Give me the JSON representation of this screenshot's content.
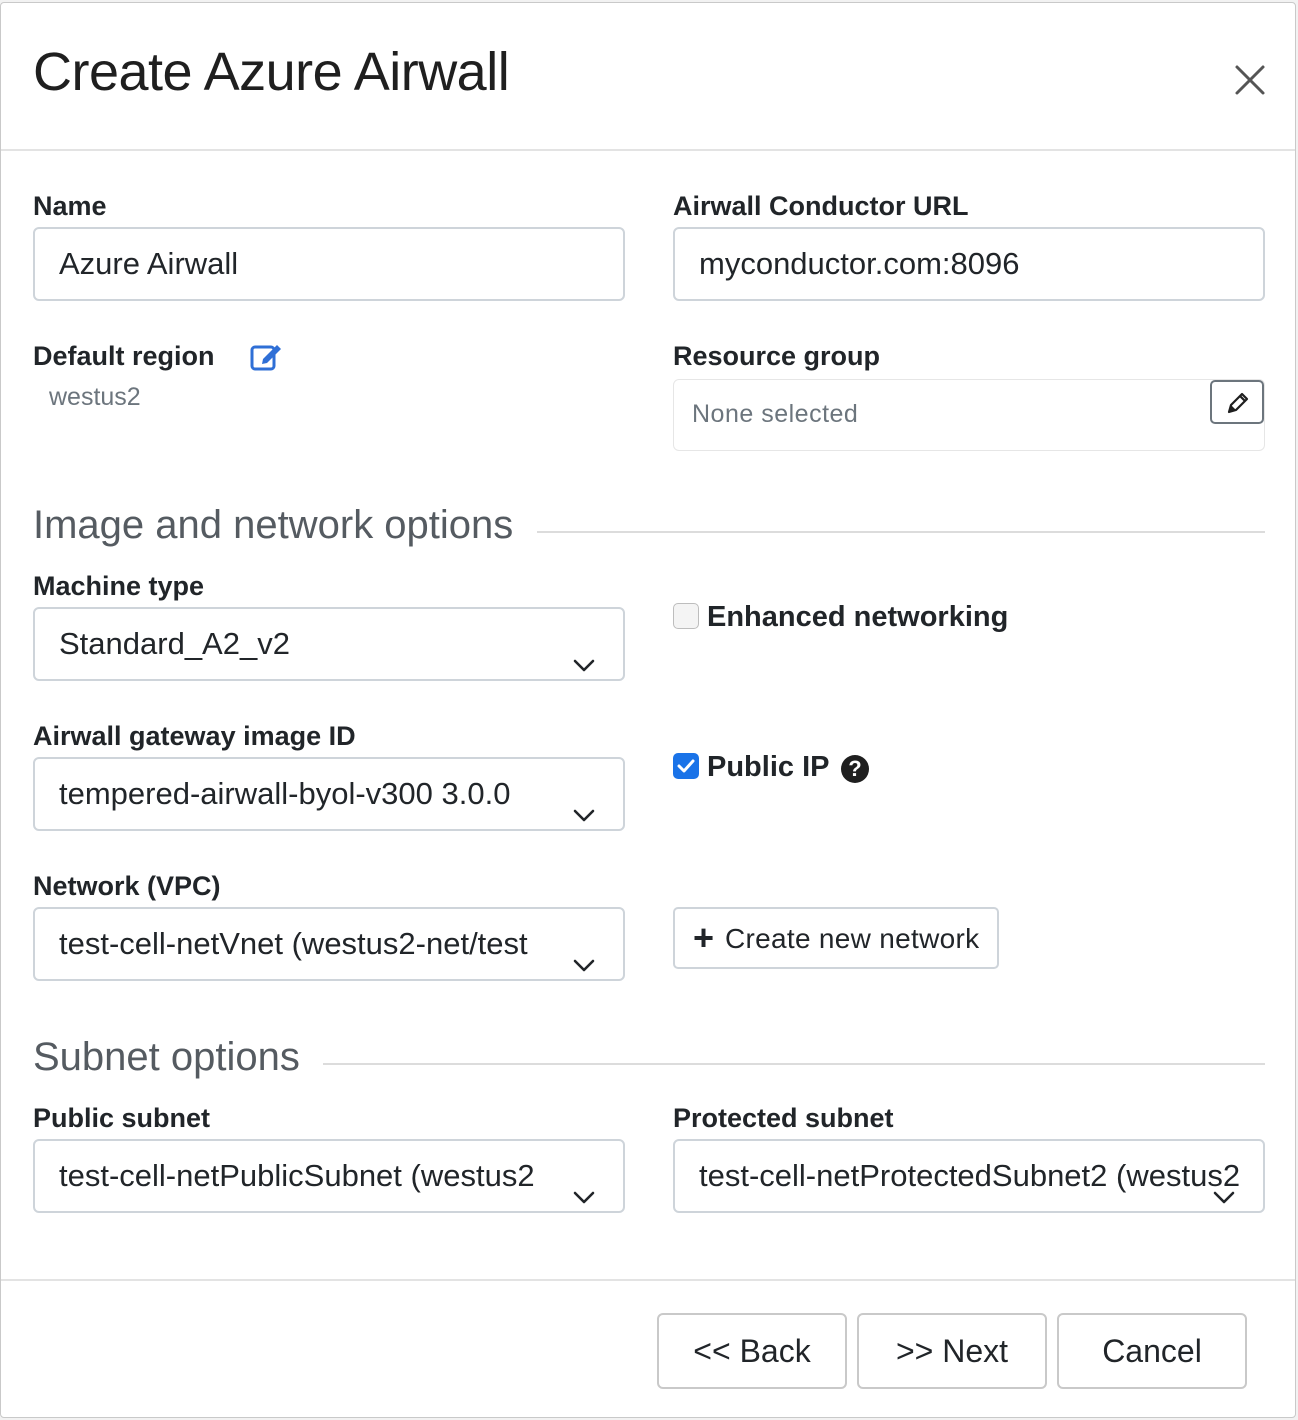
{
  "dialog": {
    "title": "Create Azure Airwall",
    "close_icon": "close-icon"
  },
  "fields": {
    "name": {
      "label": "Name",
      "value": "Azure Airwall"
    },
    "conductor_url": {
      "label": "Airwall Conductor URL",
      "value": "myconductor.com:8096"
    },
    "default_region": {
      "label": "Default region",
      "value": "westus2",
      "icon": "edit-icon"
    },
    "resource_group": {
      "label": "Resource group",
      "placeholder": "None selected",
      "icon": "pencil-icon"
    }
  },
  "sections": {
    "image_network": "Image and network options",
    "subnet": "Subnet options"
  },
  "image_network": {
    "machine_type": {
      "label": "Machine type",
      "value": "Standard_A2_v2"
    },
    "enhanced_networking": {
      "label": "Enhanced networking",
      "checked": false
    },
    "gateway_image": {
      "label": "Airwall gateway image ID",
      "value": "tempered-airwall-byol-v300 3.0.0"
    },
    "public_ip": {
      "label": "Public IP",
      "checked": true,
      "help_icon": "question-circle-icon"
    },
    "network": {
      "label": "Network (VPC)",
      "value": "test-cell-netVnet (westus2-net/test"
    },
    "create_network": {
      "label": "Create new network",
      "icon": "plus-icon"
    }
  },
  "subnet": {
    "public": {
      "label": "Public subnet",
      "value": "test-cell-netPublicSubnet (westus2"
    },
    "protected": {
      "label": "Protected subnet",
      "value": "test-cell-netProtectedSubnet2 (westus2"
    }
  },
  "footer": {
    "back": "<< Back",
    "next": ">> Next",
    "cancel": "Cancel"
  },
  "colors": {
    "accent": "#1a73e8",
    "border": "#ced4da",
    "muted_text": "#6c757d"
  }
}
